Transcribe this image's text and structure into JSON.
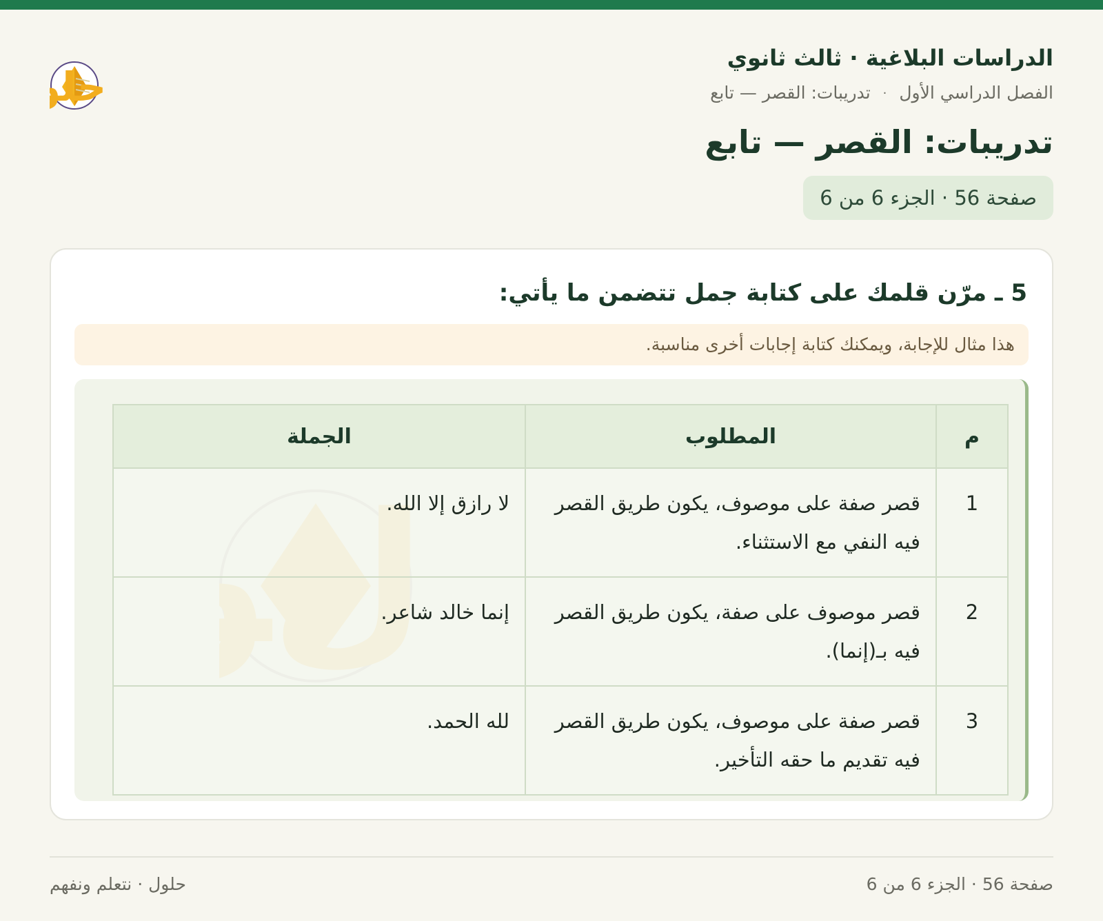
{
  "header": {
    "course_title": "الدراسات البلاغية · ثالث ثانوي",
    "breadcrumb_semester": "الفصل الدراسي الأول",
    "breadcrumb_separator": "·",
    "breadcrumb_lesson": "تدريبات: القصر — تابع",
    "page_title": "تدريبات: القصر — تابع",
    "page_badge": "صفحة 56 · الجزء 6 من 6",
    "logo_text": "حلول"
  },
  "exercise": {
    "question": "5 ـ مرّن قلمك على كتابة جمل تتضمن ما يأتي:",
    "note": "هذا مثال للإجابة، ويمكنك كتابة إجابات أخرى مناسبة.",
    "table": {
      "headers": {
        "num": "م",
        "requirement": "المطلوب",
        "sentence": "الجملة"
      },
      "rows": [
        {
          "num": "1",
          "requirement": "قصر صفة على موصوف، يكون طريق القصر فيه النفي مع الاستثناء.",
          "sentence": "لا رازق إلا الله."
        },
        {
          "num": "2",
          "requirement": "قصر موصوف على صفة، يكون طريق القصر فيه بـ(إنما).",
          "sentence": "إنما خالد شاعر."
        },
        {
          "num": "3",
          "requirement": "قصر صفة على موصوف، يكون طريق القصر فيه تقديم ما حقه التأخير.",
          "sentence": "لله الحمد."
        }
      ]
    }
  },
  "footer": {
    "page_info": "صفحة 56 · الجزء 6 من 6",
    "brand": "حلول · نتعلم ونفهم"
  },
  "colors": {
    "top_bar": "#1f7a4d",
    "title": "#1c3a2a",
    "badge_bg": "#e1ecdb",
    "note_bg": "#fdf3e3",
    "answer_panel_bg": "#f1f4ea",
    "answer_panel_border": "#9ab98a",
    "sentence_text": "#2a5d96"
  }
}
